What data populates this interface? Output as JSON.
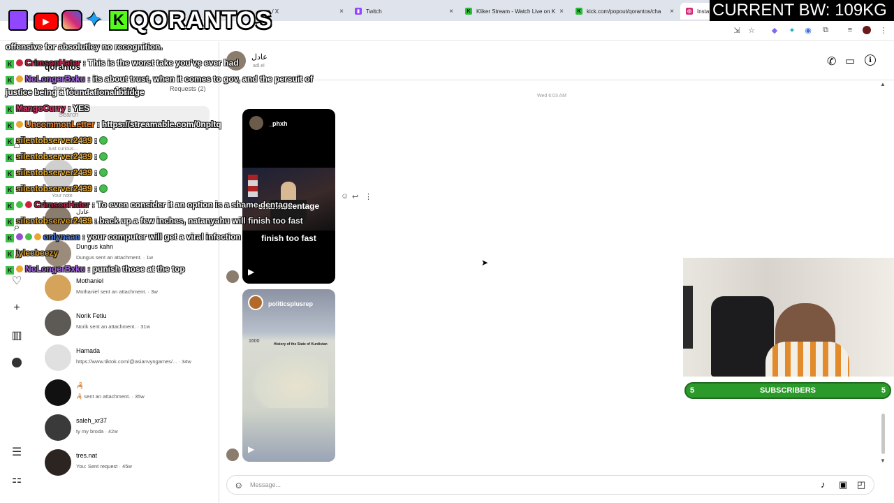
{
  "browser": {
    "tabs": [
      {
        "label": "me / X",
        "close": "×"
      },
      {
        "label": "Twitch",
        "close": "×"
      },
      {
        "label": "Kliker Stream - Watch Live on K",
        "close": "×"
      },
      {
        "label": "kick.com/popout/qorantos/cha",
        "close": "×"
      },
      {
        "label": "Insta",
        "close": ""
      }
    ]
  },
  "overlay": {
    "brand": "QORANTOS",
    "bandwidth": "CURRENT BW: 109KG",
    "subscribers_label": "SUBSCRIBERS",
    "subscribers_left": "5",
    "subscribers_right": "5",
    "colors": {
      "kick_green": "#53fc18",
      "bar_green": "#2c9a2a",
      "bw_bg": "#000000"
    },
    "chat": [
      {
        "user": "",
        "text": "offensive for absolutley no recognition.",
        "color": "#ffffff"
      },
      {
        "user": "CrimsonHater",
        "text": ": This is the worst take you've ever had",
        "color": "#b5143a"
      },
      {
        "user": "NoLongerBxku",
        "text": ": its about trust, when it comes to gov, and the persuit of",
        "color": "#9b59d9"
      },
      {
        "user": "",
        "text": "justice being a foundational bridge",
        "color": "#ffffff"
      },
      {
        "user": "MangoCurry",
        "text": ": YES",
        "color": "#e0245e"
      },
      {
        "user": "UncommonLetter",
        "text": ": https://streamable.com/0npltq",
        "color": "#e87a1a"
      },
      {
        "user": "silentobserver2439",
        "text": ":",
        "color": "#e0a020"
      },
      {
        "user": "silentobserver2439",
        "text": ":",
        "color": "#e0a020"
      },
      {
        "user": "silentobserver2439",
        "text": ":",
        "color": "#e0a020"
      },
      {
        "user": "silentobserver2439",
        "text": ":",
        "color": "#e0a020"
      },
      {
        "user": "CrimsonHater",
        "text": ": To even consider it an option is a shame dentage",
        "color": "#b5143a"
      },
      {
        "user": "silentobserver2439",
        "text": ": back up a few inches, natanyahu will finish too fast",
        "color": "#e0a020"
      },
      {
        "user": "onlynaan",
        "text": ": your computer will get a viral infection",
        "color": "#3b6fd9"
      },
      {
        "user": "jyleebeezy",
        "text": "",
        "color": "#e0a020"
      },
      {
        "user": "NoLongerBxku",
        "text": ": punish those at the top",
        "color": "#9b59d9"
      }
    ]
  },
  "instagram": {
    "account_name": "qorantos",
    "tabs": {
      "primary": "Primary",
      "general": "General",
      "requests": "Requests (2)"
    },
    "search_placeholder": "Search",
    "note_label": "Your note",
    "note_text": "Just curious...",
    "conversations": [
      {
        "name": "عادل",
        "preview": "sent an attachment. · 1d"
      },
      {
        "name": "Dungus kahn",
        "preview": "Dungus sent an attachment. · 1w"
      },
      {
        "name": "Mothaniel",
        "preview": "Mothaniel sent an attachment. · 3w"
      },
      {
        "name": "Norik Fetiu",
        "preview": "Norik sent an attachment. · 31w"
      },
      {
        "name": "Hamada",
        "preview": "https://www.tiktok.com/@asianvyngames/... · 34w"
      },
      {
        "name": "🦂",
        "preview": "🦂 sent an attachment. · 35w"
      },
      {
        "name": "saleh_xr37",
        "preview": "ty my broda · 42w"
      },
      {
        "name": "tres.nat",
        "preview": "You: Sent request · 45w"
      }
    ],
    "chat": {
      "contact_name": "عادل",
      "contact_handle": "adl.el",
      "timestamp": "Wed 6:03 AM",
      "posts": [
        {
          "author": "_phxh",
          "caption_top": "shame dentage",
          "caption_bottom": "finish too fast"
        },
        {
          "author": "politicsplusrep",
          "map_title": "History of the State of Kurdistan",
          "map_year": "1600"
        }
      ],
      "message_placeholder": "Message..."
    }
  }
}
